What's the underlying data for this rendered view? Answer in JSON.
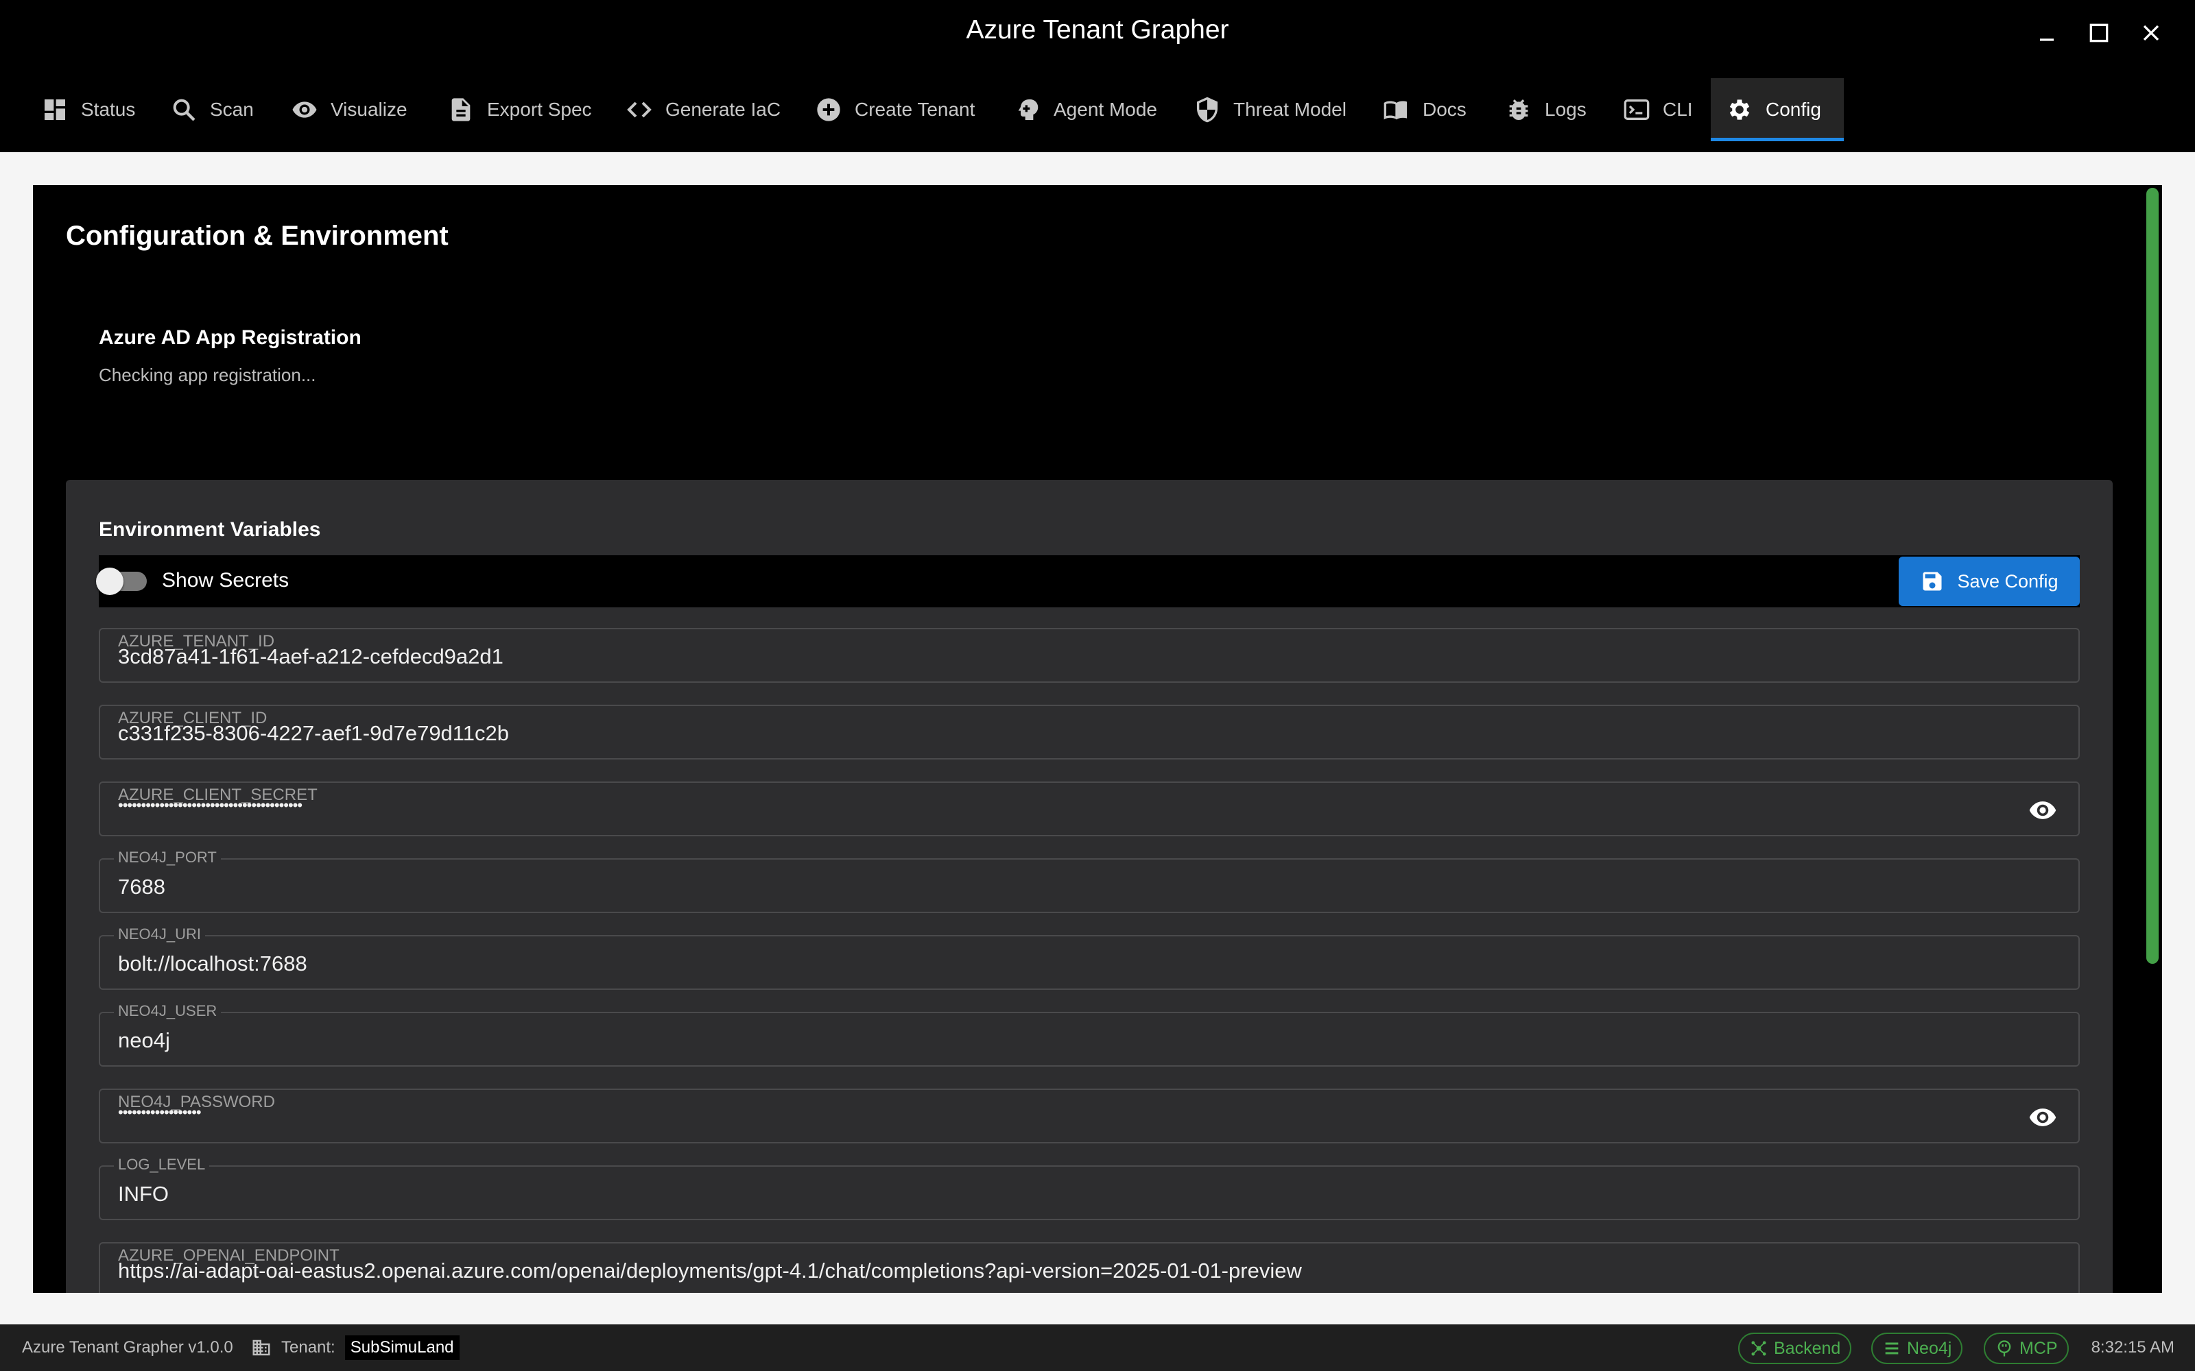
{
  "window": {
    "title": "Azure Tenant Grapher"
  },
  "tabs": [
    {
      "label": "Status",
      "icon": "dashboard-icon"
    },
    {
      "label": "Scan",
      "icon": "search-icon"
    },
    {
      "label": "Visualize",
      "icon": "eye-icon"
    },
    {
      "label": "Export Spec",
      "icon": "document-icon"
    },
    {
      "label": "Generate IaC",
      "icon": "code-icon"
    },
    {
      "label": "Create Tenant",
      "icon": "add-circle-icon"
    },
    {
      "label": "Agent Mode",
      "icon": "brain-icon"
    },
    {
      "label": "Threat Model",
      "icon": "shield-icon"
    },
    {
      "label": "Docs",
      "icon": "book-icon"
    },
    {
      "label": "Logs",
      "icon": "bug-icon"
    },
    {
      "label": "CLI",
      "icon": "terminal-icon"
    },
    {
      "label": "Config",
      "icon": "gear-icon",
      "active": true
    }
  ],
  "page": {
    "title": "Configuration & Environment",
    "app_registration": {
      "title": "Azure AD App Registration",
      "status": "Checking app registration..."
    },
    "env": {
      "title": "Environment Variables",
      "show_secrets_label": "Show Secrets",
      "show_secrets": false,
      "save_label": "Save Config",
      "fields": [
        {
          "label": "AZURE_TENANT_ID",
          "value": "3cd87a41-1f61-4aef-a212-cefdecd9a2d1"
        },
        {
          "label": "AZURE_CLIENT_ID",
          "value": "c331f235-8306-4227-aef1-9d7e79d11c2b"
        },
        {
          "label": "AZURE_CLIENT_SECRET",
          "value": "••••••••••••••••••••••••••••••••••••••••",
          "secret": true
        },
        {
          "label": "NEO4J_PORT",
          "value": "7688"
        },
        {
          "label": "NEO4J_URI",
          "value": "bolt://localhost:7688"
        },
        {
          "label": "NEO4J_USER",
          "value": "neo4j"
        },
        {
          "label": "NEO4J_PASSWORD",
          "value": "••••••••••••••••••",
          "secret": true
        },
        {
          "label": "LOG_LEVEL",
          "value": "INFO"
        },
        {
          "label": "AZURE_OPENAI_ENDPOINT",
          "value": "https://ai-adapt-oai-eastus2.openai.azure.com/openai/deployments/gpt-4.1/chat/completions?api-version=2025-01-01-preview"
        }
      ]
    }
  },
  "statusbar": {
    "version": "Azure Tenant Grapher v1.0.0",
    "tenant_label": "Tenant:",
    "tenant_name": "SubSimuLand",
    "services": [
      {
        "label": "Backend",
        "icon": "hub-icon"
      },
      {
        "label": "Neo4j",
        "icon": "list-icon"
      },
      {
        "label": "MCP",
        "icon": "plug-icon"
      }
    ],
    "time": "8:32:15 AM"
  },
  "colors": {
    "accent": "#1e88e5",
    "save_button": "#1976d2",
    "status_ok": "#4caf50",
    "scrollbar": "#43a047"
  }
}
